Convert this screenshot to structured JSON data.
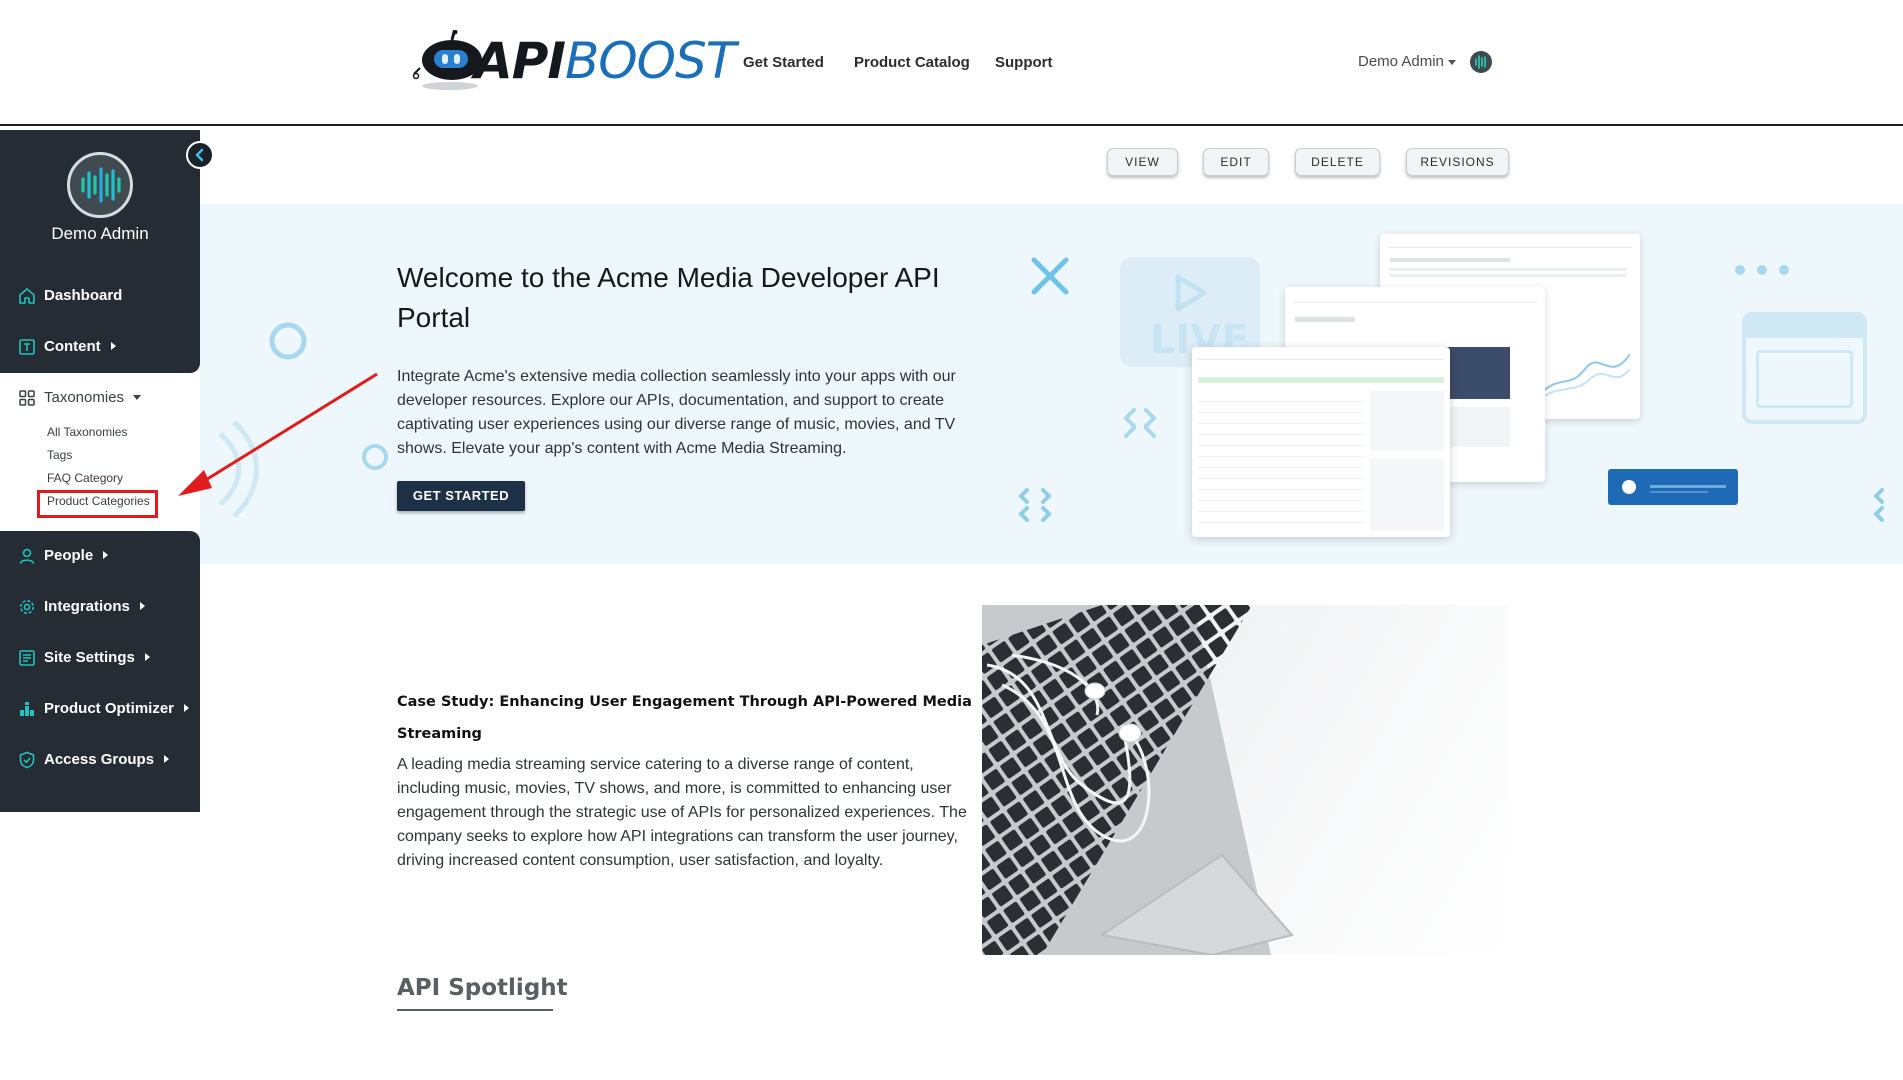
{
  "header": {
    "logo_text_bold": "API",
    "logo_text_light": "BOOST",
    "nav": [
      "Get Started",
      "Product Catalog",
      "Support"
    ],
    "user_name": "Demo Admin"
  },
  "sidebar": {
    "user_name": "Demo Admin",
    "items": [
      {
        "label": "Dashboard",
        "icon": "home-icon"
      },
      {
        "label": "Content",
        "icon": "content-icon"
      },
      {
        "label": "Taxonomies",
        "icon": "grid-icon"
      },
      {
        "label": "People",
        "icon": "person-icon"
      },
      {
        "label": "Integrations",
        "icon": "gear-icon"
      },
      {
        "label": "Site Settings",
        "icon": "settings-list-icon"
      },
      {
        "label": "Product Optimizer",
        "icon": "optimizer-icon"
      },
      {
        "label": "Access Groups",
        "icon": "shield-icon"
      }
    ],
    "taxonomy_sub": [
      "All Taxonomies",
      "Tags",
      "FAQ Category",
      "Product Categories"
    ],
    "highlighted": "Product Categories",
    "accent_color": "#20c4c0",
    "highlight_color": "#e01b1b"
  },
  "admin_buttons": [
    "VIEW",
    "EDIT",
    "DELETE",
    "REVISIONS"
  ],
  "hero": {
    "title": "Welcome to the Acme Media Developer API Portal",
    "text": "Integrate Acme's extensive media collection seamlessly into your apps with our developer resources. Explore our APIs, documentation, and support to create captivating user experiences using our diverse range of music, movies, and TV shows. Elevate your app's content with Acme Media Streaming.",
    "cta": "GET STARTED",
    "bg_color": "#eef7fb",
    "cta_color": "#1c3145",
    "deco_live_text": "LIVE"
  },
  "case_study": {
    "title": "Case Study: Enhancing User Engagement Through API-Powered Media Streaming",
    "text": "A leading media streaming service catering to a diverse range of content, including music, movies, TV shows, and more, is committed to enhancing user engagement through the strategic use of APIs for personalized experiences. The company seeks to explore how API integrations can transform the user journey, driving increased content consumption, user satisfaction, and loyalty."
  },
  "spotlight": {
    "title": "API Spotlight"
  }
}
